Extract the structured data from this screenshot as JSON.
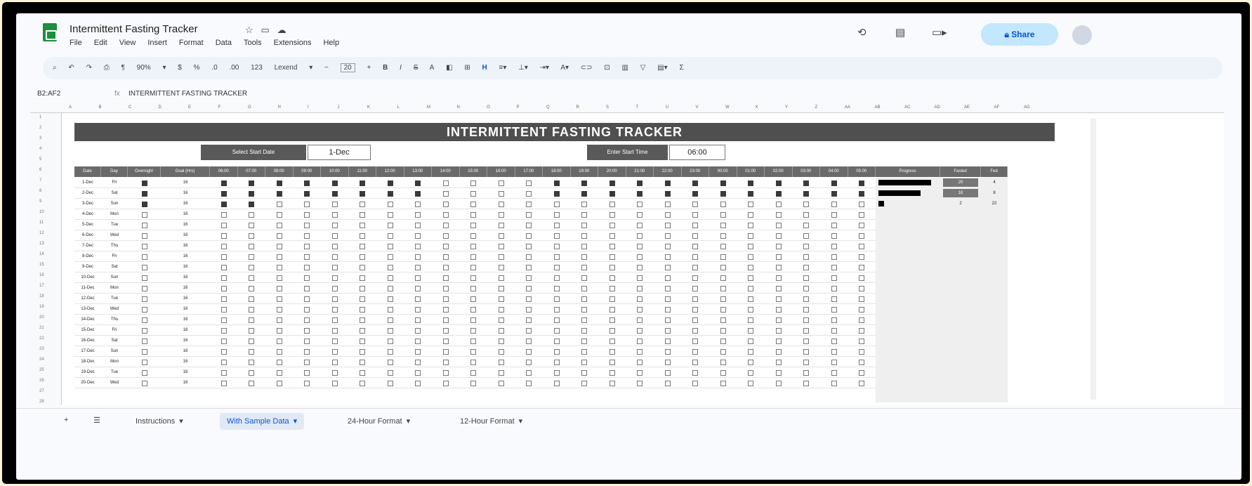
{
  "title": "Intermittent Fasting Tracker",
  "menu": [
    "File",
    "Edit",
    "View",
    "Insert",
    "Format",
    "Data",
    "Tools",
    "Extensions",
    "Help"
  ],
  "share_label": "Share",
  "toolbar": {
    "zoom": "90%",
    "font": "Lexend",
    "font_size": "20"
  },
  "cell_ref": "B2:AF2",
  "formula": "INTERMITTENT FASTING TRACKER",
  "banner": "INTERMITTENT FASTING TRACKER",
  "start_date_label": "Select Start Date",
  "start_date": "1-Dec",
  "start_time_label": "Enter Start Time",
  "start_time": "06:00",
  "columns": {
    "date": "Date",
    "day": "Day",
    "overnight": "Overnight",
    "goal": "Goal (Hrs)",
    "hours": [
      "06:00",
      "07:00",
      "08:00",
      "09:00",
      "10:00",
      "11:00",
      "12:00",
      "13:00",
      "14:00",
      "15:00",
      "16:00",
      "17:00",
      "18:00",
      "19:00",
      "20:00",
      "21:00",
      "22:00",
      "23:00",
      "00:00",
      "01:00",
      "02:00",
      "03:00",
      "04:00",
      "05:00"
    ],
    "progress": "Progress",
    "fasted": "Fasted",
    "fed": "Fed"
  },
  "rows": [
    {
      "date": "1-Dec",
      "day": "Fri",
      "goal": "16",
      "checks": [
        1,
        1,
        1,
        1,
        1,
        1,
        1,
        1,
        1,
        0,
        0,
        0,
        0,
        1,
        1,
        1,
        1,
        1,
        1,
        1,
        1,
        1,
        1,
        1,
        1
      ],
      "progress": 1,
      "fasted": "20",
      "fed": "4"
    },
    {
      "date": "2-Dec",
      "day": "Sat",
      "goal": "16",
      "checks": [
        1,
        1,
        1,
        1,
        1,
        1,
        1,
        1,
        1,
        0,
        0,
        0,
        0,
        1,
        1,
        1,
        1,
        1,
        1,
        1,
        1,
        1,
        1,
        1,
        1
      ],
      "progress": 0.8,
      "fasted": "16",
      "fed": "8"
    },
    {
      "date": "3-Dec",
      "day": "Sun",
      "goal": "16",
      "checks": [
        1,
        1,
        1,
        0,
        0,
        0,
        0,
        0,
        0,
        0,
        0,
        0,
        0,
        0,
        0,
        0,
        0,
        0,
        0,
        0,
        0,
        0,
        0,
        0,
        0
      ],
      "progress": 0.1,
      "fasted": "2",
      "fed": "22"
    },
    {
      "date": "4-Dec",
      "day": "Mon",
      "goal": "16"
    },
    {
      "date": "5-Dec",
      "day": "Tue",
      "goal": "16"
    },
    {
      "date": "6-Dec",
      "day": "Wed",
      "goal": "16"
    },
    {
      "date": "7-Dec",
      "day": "Thu",
      "goal": "16"
    },
    {
      "date": "8-Dec",
      "day": "Fri",
      "goal": "16"
    },
    {
      "date": "9-Dec",
      "day": "Sat",
      "goal": "16"
    },
    {
      "date": "10-Dec",
      "day": "Sun",
      "goal": "16"
    },
    {
      "date": "11-Dec",
      "day": "Mon",
      "goal": "16"
    },
    {
      "date": "12-Dec",
      "day": "Tue",
      "goal": "16"
    },
    {
      "date": "13-Dec",
      "day": "Wed",
      "goal": "16"
    },
    {
      "date": "14-Dec",
      "day": "Thu",
      "goal": "16"
    },
    {
      "date": "15-Dec",
      "day": "Fri",
      "goal": "16"
    },
    {
      "date": "16-Dec",
      "day": "Sat",
      "goal": "16"
    },
    {
      "date": "17-Dec",
      "day": "Sun",
      "goal": "16"
    },
    {
      "date": "18-Dec",
      "day": "Mon",
      "goal": "16"
    },
    {
      "date": "19-Dec",
      "day": "Tue",
      "goal": "16"
    },
    {
      "date": "20-Dec",
      "day": "Wed",
      "goal": "16"
    }
  ],
  "tabs": [
    {
      "label": "Instructions",
      "active": false
    },
    {
      "label": "With Sample Data",
      "active": true
    },
    {
      "label": "24-Hour Format",
      "active": false
    },
    {
      "label": "12-Hour Format",
      "active": false
    }
  ],
  "colors": {
    "banner": "#4f4f4f",
    "checked": "#3a3a3a",
    "accent": "#0b57d0"
  }
}
